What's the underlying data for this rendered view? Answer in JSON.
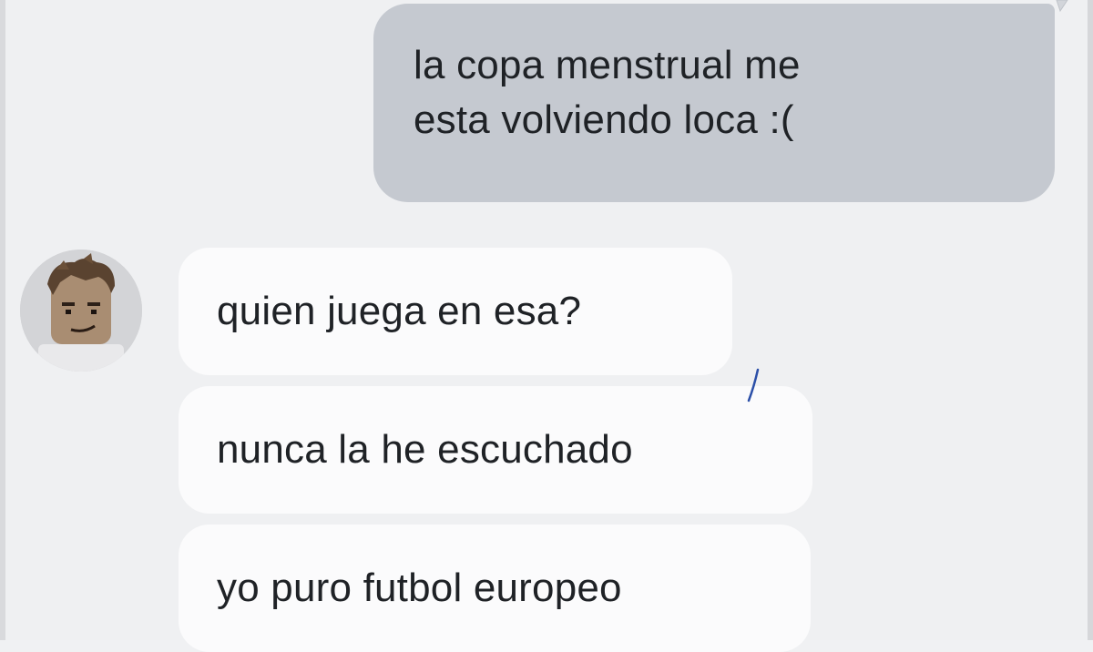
{
  "conversation": {
    "outgoing": [
      {
        "line1": "la copa menstrual me",
        "line2": "esta volviendo loca :("
      }
    ],
    "incoming": [
      {
        "text": "quien juega en esa?"
      },
      {
        "text": "nunca la he escuchado"
      },
      {
        "text": "yo puro futbol europeo"
      }
    ]
  },
  "contact": {
    "avatar_icon": "roblox-avatar-icon"
  },
  "colors": {
    "background": "#eff0f2",
    "outgoing_bubble": "#c5c9d0",
    "incoming_bubble": "#fbfbfc",
    "text": "#1f2226",
    "pen_mark": "#2b4fa8"
  }
}
